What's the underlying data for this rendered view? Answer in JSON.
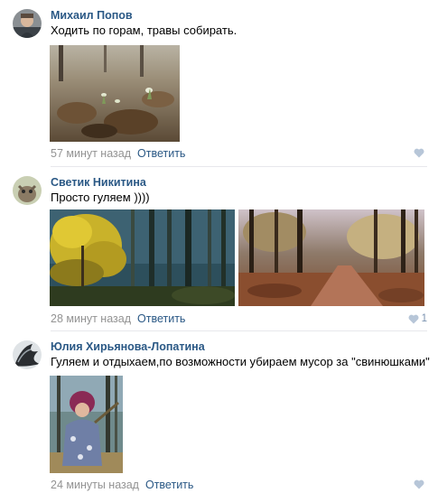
{
  "comments": [
    {
      "author": "Михаил Попов",
      "text": "Ходить по горам, травы собирать.",
      "time": "57 минут назад",
      "reply": "Ответить",
      "likes": ""
    },
    {
      "author": "Светик Никитина",
      "text": "Просто гуляем ))))",
      "time": "28 минут назад",
      "reply": "Ответить",
      "likes": "1"
    },
    {
      "author": "Юлия Хирьянова-Лопатина",
      "text": "Гуляем и отдыхаем,по возможности убираем мусор за \"свинюшками\"",
      "time": "24 минуты назад",
      "reply": "Ответить",
      "likes": ""
    }
  ],
  "colors": {
    "author_link": "#2a5885",
    "meta_gray": "#939393",
    "like_heart": "#a3b7cf",
    "divider": "#e7e8ec"
  },
  "icons": {
    "like": "heart-icon"
  }
}
